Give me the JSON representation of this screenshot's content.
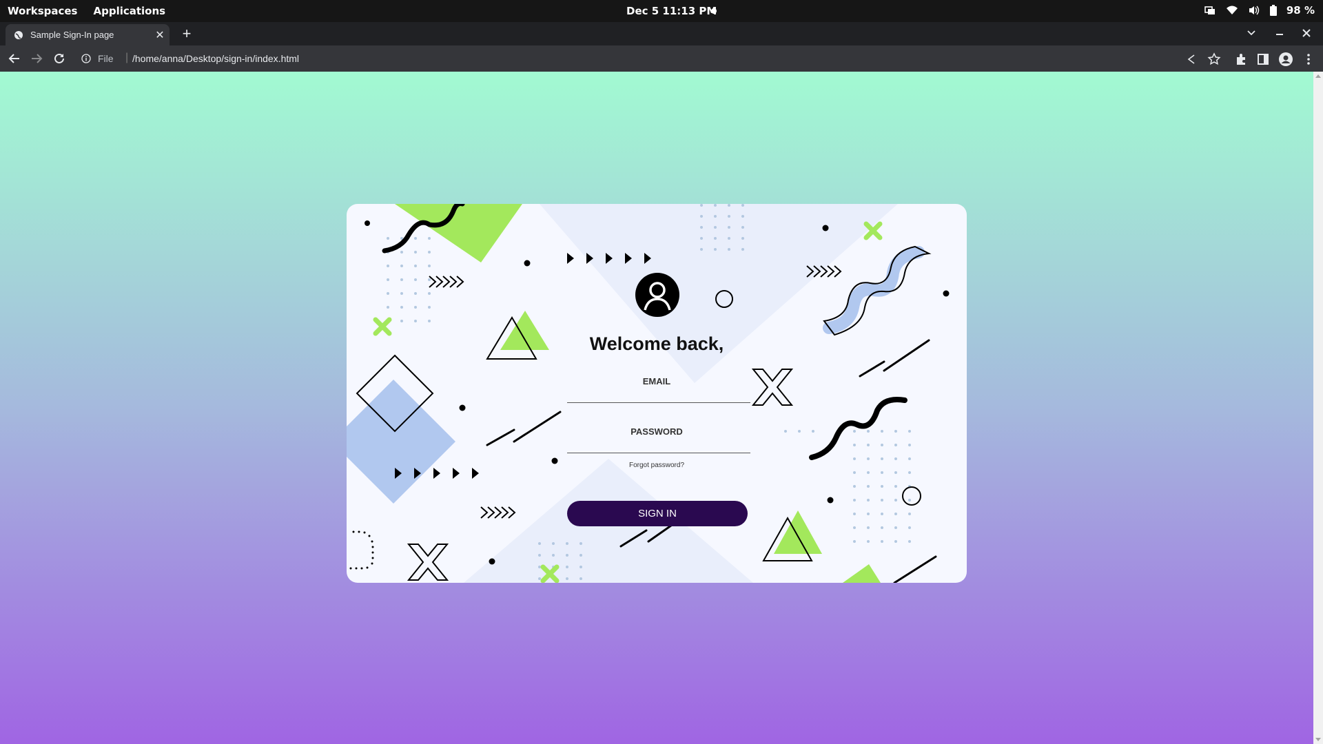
{
  "system_bar": {
    "workspaces": "Workspaces",
    "applications": "Applications",
    "clock": "Dec 5  11:13 PM",
    "battery": "98 %"
  },
  "browser": {
    "tab_title": "Sample Sign-In page",
    "scheme_label": "File",
    "url": "/home/anna/Desktop/sign-in/index.html"
  },
  "page": {
    "colors": {
      "gradient_top": "#a2fad2",
      "gradient_bottom": "#a065e3",
      "accent_green": "#a3e85c",
      "accent_blue": "#b1c8ef",
      "button": "#2a0950"
    },
    "heading": "Welcome back,",
    "email_label": "EMAIL",
    "email_value": "",
    "password_label": "PASSWORD",
    "password_value": "",
    "forgot_link": "Forgot password?",
    "signin_button": "SIGN IN"
  }
}
